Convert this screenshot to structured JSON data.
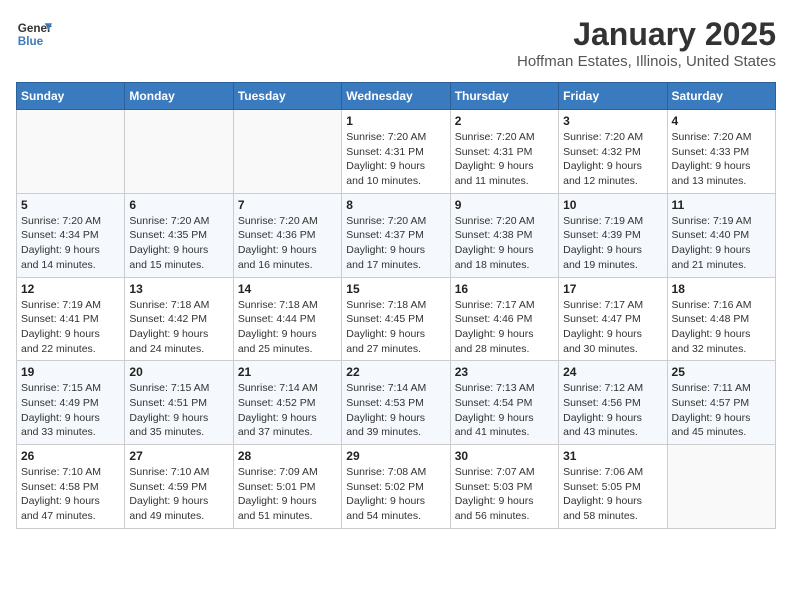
{
  "header": {
    "logo_line1": "General",
    "logo_line2": "Blue",
    "title": "January 2025",
    "subtitle": "Hoffman Estates, Illinois, United States"
  },
  "calendar": {
    "days_of_week": [
      "Sunday",
      "Monday",
      "Tuesday",
      "Wednesday",
      "Thursday",
      "Friday",
      "Saturday"
    ],
    "weeks": [
      [
        {
          "day": "",
          "info": ""
        },
        {
          "day": "",
          "info": ""
        },
        {
          "day": "",
          "info": ""
        },
        {
          "day": "1",
          "info": "Sunrise: 7:20 AM\nSunset: 4:31 PM\nDaylight: 9 hours\nand 10 minutes."
        },
        {
          "day": "2",
          "info": "Sunrise: 7:20 AM\nSunset: 4:31 PM\nDaylight: 9 hours\nand 11 minutes."
        },
        {
          "day": "3",
          "info": "Sunrise: 7:20 AM\nSunset: 4:32 PM\nDaylight: 9 hours\nand 12 minutes."
        },
        {
          "day": "4",
          "info": "Sunrise: 7:20 AM\nSunset: 4:33 PM\nDaylight: 9 hours\nand 13 minutes."
        }
      ],
      [
        {
          "day": "5",
          "info": "Sunrise: 7:20 AM\nSunset: 4:34 PM\nDaylight: 9 hours\nand 14 minutes."
        },
        {
          "day": "6",
          "info": "Sunrise: 7:20 AM\nSunset: 4:35 PM\nDaylight: 9 hours\nand 15 minutes."
        },
        {
          "day": "7",
          "info": "Sunrise: 7:20 AM\nSunset: 4:36 PM\nDaylight: 9 hours\nand 16 minutes."
        },
        {
          "day": "8",
          "info": "Sunrise: 7:20 AM\nSunset: 4:37 PM\nDaylight: 9 hours\nand 17 minutes."
        },
        {
          "day": "9",
          "info": "Sunrise: 7:20 AM\nSunset: 4:38 PM\nDaylight: 9 hours\nand 18 minutes."
        },
        {
          "day": "10",
          "info": "Sunrise: 7:19 AM\nSunset: 4:39 PM\nDaylight: 9 hours\nand 19 minutes."
        },
        {
          "day": "11",
          "info": "Sunrise: 7:19 AM\nSunset: 4:40 PM\nDaylight: 9 hours\nand 21 minutes."
        }
      ],
      [
        {
          "day": "12",
          "info": "Sunrise: 7:19 AM\nSunset: 4:41 PM\nDaylight: 9 hours\nand 22 minutes."
        },
        {
          "day": "13",
          "info": "Sunrise: 7:18 AM\nSunset: 4:42 PM\nDaylight: 9 hours\nand 24 minutes."
        },
        {
          "day": "14",
          "info": "Sunrise: 7:18 AM\nSunset: 4:44 PM\nDaylight: 9 hours\nand 25 minutes."
        },
        {
          "day": "15",
          "info": "Sunrise: 7:18 AM\nSunset: 4:45 PM\nDaylight: 9 hours\nand 27 minutes."
        },
        {
          "day": "16",
          "info": "Sunrise: 7:17 AM\nSunset: 4:46 PM\nDaylight: 9 hours\nand 28 minutes."
        },
        {
          "day": "17",
          "info": "Sunrise: 7:17 AM\nSunset: 4:47 PM\nDaylight: 9 hours\nand 30 minutes."
        },
        {
          "day": "18",
          "info": "Sunrise: 7:16 AM\nSunset: 4:48 PM\nDaylight: 9 hours\nand 32 minutes."
        }
      ],
      [
        {
          "day": "19",
          "info": "Sunrise: 7:15 AM\nSunset: 4:49 PM\nDaylight: 9 hours\nand 33 minutes."
        },
        {
          "day": "20",
          "info": "Sunrise: 7:15 AM\nSunset: 4:51 PM\nDaylight: 9 hours\nand 35 minutes."
        },
        {
          "day": "21",
          "info": "Sunrise: 7:14 AM\nSunset: 4:52 PM\nDaylight: 9 hours\nand 37 minutes."
        },
        {
          "day": "22",
          "info": "Sunrise: 7:14 AM\nSunset: 4:53 PM\nDaylight: 9 hours\nand 39 minutes."
        },
        {
          "day": "23",
          "info": "Sunrise: 7:13 AM\nSunset: 4:54 PM\nDaylight: 9 hours\nand 41 minutes."
        },
        {
          "day": "24",
          "info": "Sunrise: 7:12 AM\nSunset: 4:56 PM\nDaylight: 9 hours\nand 43 minutes."
        },
        {
          "day": "25",
          "info": "Sunrise: 7:11 AM\nSunset: 4:57 PM\nDaylight: 9 hours\nand 45 minutes."
        }
      ],
      [
        {
          "day": "26",
          "info": "Sunrise: 7:10 AM\nSunset: 4:58 PM\nDaylight: 9 hours\nand 47 minutes."
        },
        {
          "day": "27",
          "info": "Sunrise: 7:10 AM\nSunset: 4:59 PM\nDaylight: 9 hours\nand 49 minutes."
        },
        {
          "day": "28",
          "info": "Sunrise: 7:09 AM\nSunset: 5:01 PM\nDaylight: 9 hours\nand 51 minutes."
        },
        {
          "day": "29",
          "info": "Sunrise: 7:08 AM\nSunset: 5:02 PM\nDaylight: 9 hours\nand 54 minutes."
        },
        {
          "day": "30",
          "info": "Sunrise: 7:07 AM\nSunset: 5:03 PM\nDaylight: 9 hours\nand 56 minutes."
        },
        {
          "day": "31",
          "info": "Sunrise: 7:06 AM\nSunset: 5:05 PM\nDaylight: 9 hours\nand 58 minutes."
        },
        {
          "day": "",
          "info": ""
        }
      ]
    ]
  }
}
